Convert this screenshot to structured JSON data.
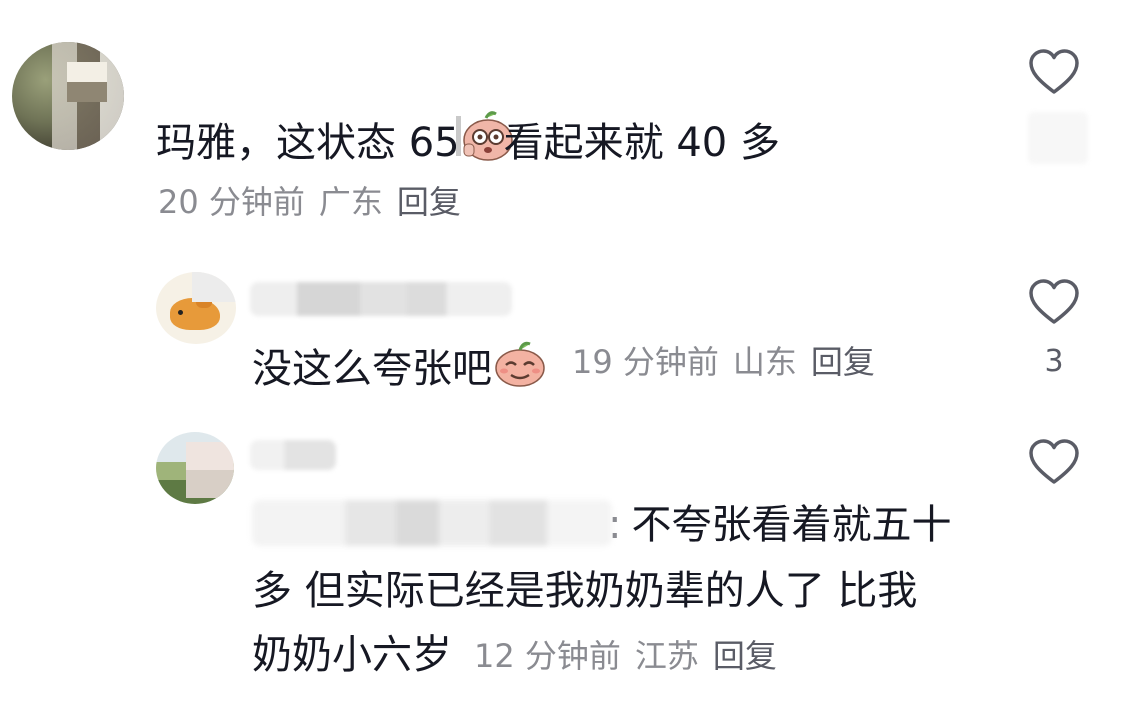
{
  "comments": [
    {
      "text_before": "玛雅，这状态 65",
      "emoji": "peach-face-glasses-icon",
      "text_after": "看起来就 40 多",
      "time": "20 分钟前",
      "location": "广东",
      "reply_label": "回复"
    }
  ],
  "replies": [
    {
      "text": "没这么夸张吧",
      "emoji": "peach-face-smile-icon",
      "time": "19 分钟前",
      "location": "山东",
      "reply_label": "回复",
      "likes": "3"
    },
    {
      "separator": ":",
      "line1": "不夸张看着就五十",
      "line2": "多  但实际已经是我奶奶辈的人了  比我",
      "line3": "奶奶小六岁",
      "time": "12 分钟前",
      "location": "江苏",
      "reply_label": "回复"
    }
  ]
}
